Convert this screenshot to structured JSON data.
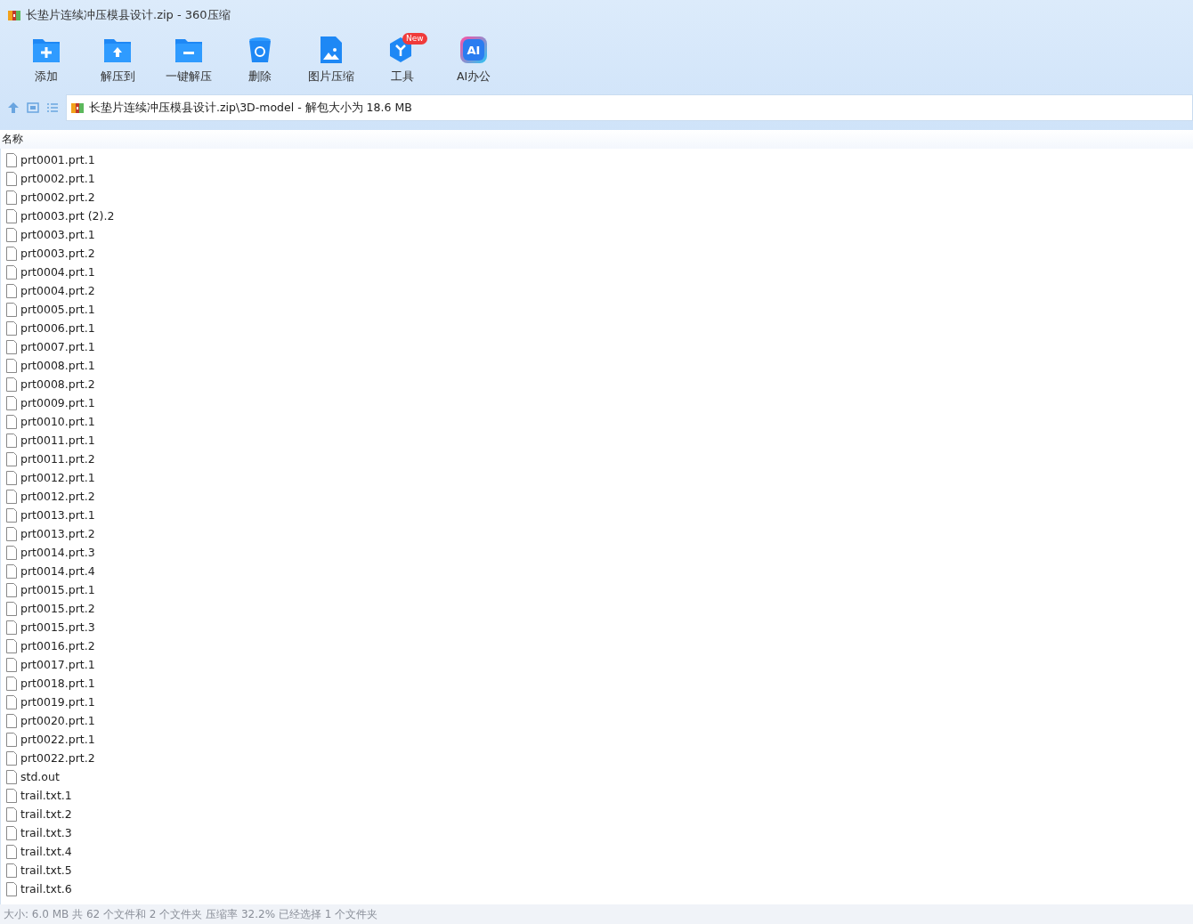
{
  "window": {
    "title": "长垫片连续冲压模县设计.zip - 360压缩"
  },
  "toolbar": [
    {
      "kind": "add",
      "label": "添加"
    },
    {
      "kind": "extract",
      "label": "解压到"
    },
    {
      "kind": "oneclick",
      "label": "一键解压"
    },
    {
      "kind": "delete",
      "label": "删除"
    },
    {
      "kind": "image",
      "label": "图片压缩"
    },
    {
      "kind": "tools",
      "label": "工具",
      "badge": "New"
    },
    {
      "kind": "ai",
      "icon_text": "AI",
      "label": "AI办公"
    }
  ],
  "address": {
    "path": "长垫片连续冲压模县设计.zip\\3D-model - 解包大小为 18.6 MB"
  },
  "table": {
    "columns": [
      "名称"
    ],
    "rows": [
      "prt0001.prt.1",
      "prt0002.prt.1",
      "prt0002.prt.2",
      "prt0003.prt (2).2",
      "prt0003.prt.1",
      "prt0003.prt.2",
      "prt0004.prt.1",
      "prt0004.prt.2",
      "prt0005.prt.1",
      "prt0006.prt.1",
      "prt0007.prt.1",
      "prt0008.prt.1",
      "prt0008.prt.2",
      "prt0009.prt.1",
      "prt0010.prt.1",
      "prt0011.prt.1",
      "prt0011.prt.2",
      "prt0012.prt.1",
      "prt0012.prt.2",
      "prt0013.prt.1",
      "prt0013.prt.2",
      "prt0014.prt.3",
      "prt0014.prt.4",
      "prt0015.prt.1",
      "prt0015.prt.2",
      "prt0015.prt.3",
      "prt0016.prt.2",
      "prt0017.prt.1",
      "prt0018.prt.1",
      "prt0019.prt.1",
      "prt0020.prt.1",
      "prt0022.prt.1",
      "prt0022.prt.2",
      "std.out",
      "trail.txt.1",
      "trail.txt.2",
      "trail.txt.3",
      "trail.txt.4",
      "trail.txt.5",
      "trail.txt.6"
    ]
  },
  "status_bar": "大小: 6.0 MB 共 62 个文件和 2 个文件夹 压缩率 32.2% 已经选择 1 个文件夹"
}
